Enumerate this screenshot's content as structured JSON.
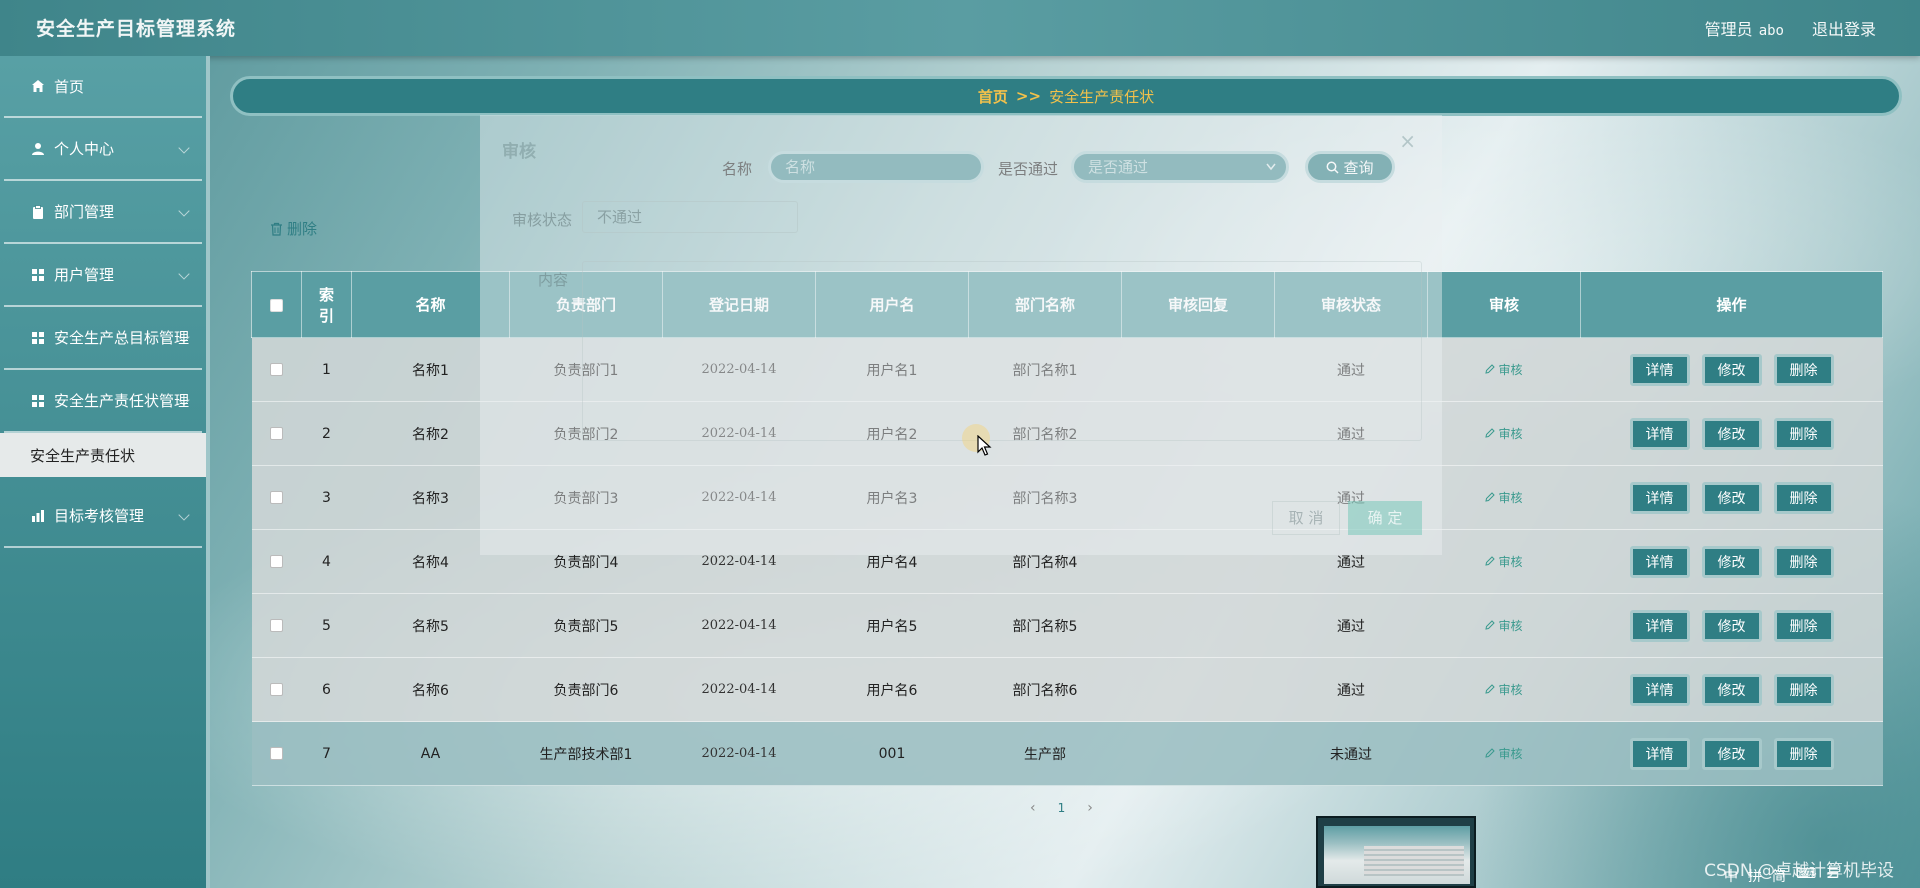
{
  "app": {
    "title": "安全生产目标管理系统"
  },
  "header": {
    "role": "管理员",
    "username": "abo",
    "logout": "退出登录"
  },
  "sidebar": {
    "items": [
      {
        "label": "首页",
        "icon": "home-icon"
      },
      {
        "label": "个人中心",
        "icon": "user-icon"
      },
      {
        "label": "部门管理",
        "icon": "clipboard-icon"
      },
      {
        "label": "用户管理",
        "icon": "grid-icon"
      },
      {
        "label": "安全生产总目标管理",
        "icon": "grid-icon"
      },
      {
        "label": "安全生产责任状管理",
        "icon": "grid-icon"
      },
      {
        "label": "安全生产责任状",
        "icon": ""
      },
      {
        "label": "目标考核管理",
        "icon": "chart-icon"
      }
    ]
  },
  "breadcrumb": {
    "home": "首页",
    "separator": ">>",
    "current": "安全生产责任状"
  },
  "search": {
    "name_label": "名称",
    "name_placeholder": "名称",
    "passed_label": "是否通过",
    "passed_placeholder": "是否通过",
    "query_label": "查询"
  },
  "toolbar": {
    "delete_label": "删除"
  },
  "table": {
    "headers": [
      "索引",
      "名称",
      "负责部门",
      "登记日期",
      "用户名",
      "部门名称",
      "审核回复",
      "审核状态",
      "审核",
      "操作"
    ],
    "index_header_top": "索",
    "index_header_bottom": "引",
    "audit_link": "审核",
    "actions": {
      "detail": "详情",
      "edit": "修改",
      "delete": "删除"
    },
    "rows": [
      {
        "index": "1",
        "name": "名称1",
        "dept": "负责部门1",
        "date": "2022-04-14",
        "username": "用户名1",
        "dept_name": "部门名称1",
        "reply": "",
        "status": "通过"
      },
      {
        "index": "2",
        "name": "名称2",
        "dept": "负责部门2",
        "date": "2022-04-14",
        "username": "用户名2",
        "dept_name": "部门名称2",
        "reply": "",
        "status": "通过"
      },
      {
        "index": "3",
        "name": "名称3",
        "dept": "负责部门3",
        "date": "2022-04-14",
        "username": "用户名3",
        "dept_name": "部门名称3",
        "reply": "",
        "status": "通过"
      },
      {
        "index": "4",
        "name": "名称4",
        "dept": "负责部门4",
        "date": "2022-04-14",
        "username": "用户名4",
        "dept_name": "部门名称4",
        "reply": "",
        "status": "通过"
      },
      {
        "index": "5",
        "name": "名称5",
        "dept": "负责部门5",
        "date": "2022-04-14",
        "username": "用户名5",
        "dept_name": "部门名称5",
        "reply": "",
        "status": "通过"
      },
      {
        "index": "6",
        "name": "名称6",
        "dept": "负责部门6",
        "date": "2022-04-14",
        "username": "用户名6",
        "dept_name": "部门名称6",
        "reply": "",
        "status": "通过"
      },
      {
        "index": "7",
        "name": "AA",
        "dept": "生产部技术部1",
        "date": "2022-04-14",
        "username": "001",
        "dept_name": "生产部",
        "reply": "",
        "status": "未通过"
      }
    ]
  },
  "pagination": {
    "prev": "‹",
    "current": "1",
    "next": "›"
  },
  "dialog": {
    "title": "审核",
    "close": "×",
    "status_label": "审核状态",
    "status_value": "不通过",
    "content_label": "内容",
    "cancel": "取 消",
    "confirm": "确 定"
  },
  "watermark": "CSDN @卓越计算机毕设",
  "tray": [
    "中",
    "拼",
    "简",
    "⌨",
    "☰"
  ]
}
